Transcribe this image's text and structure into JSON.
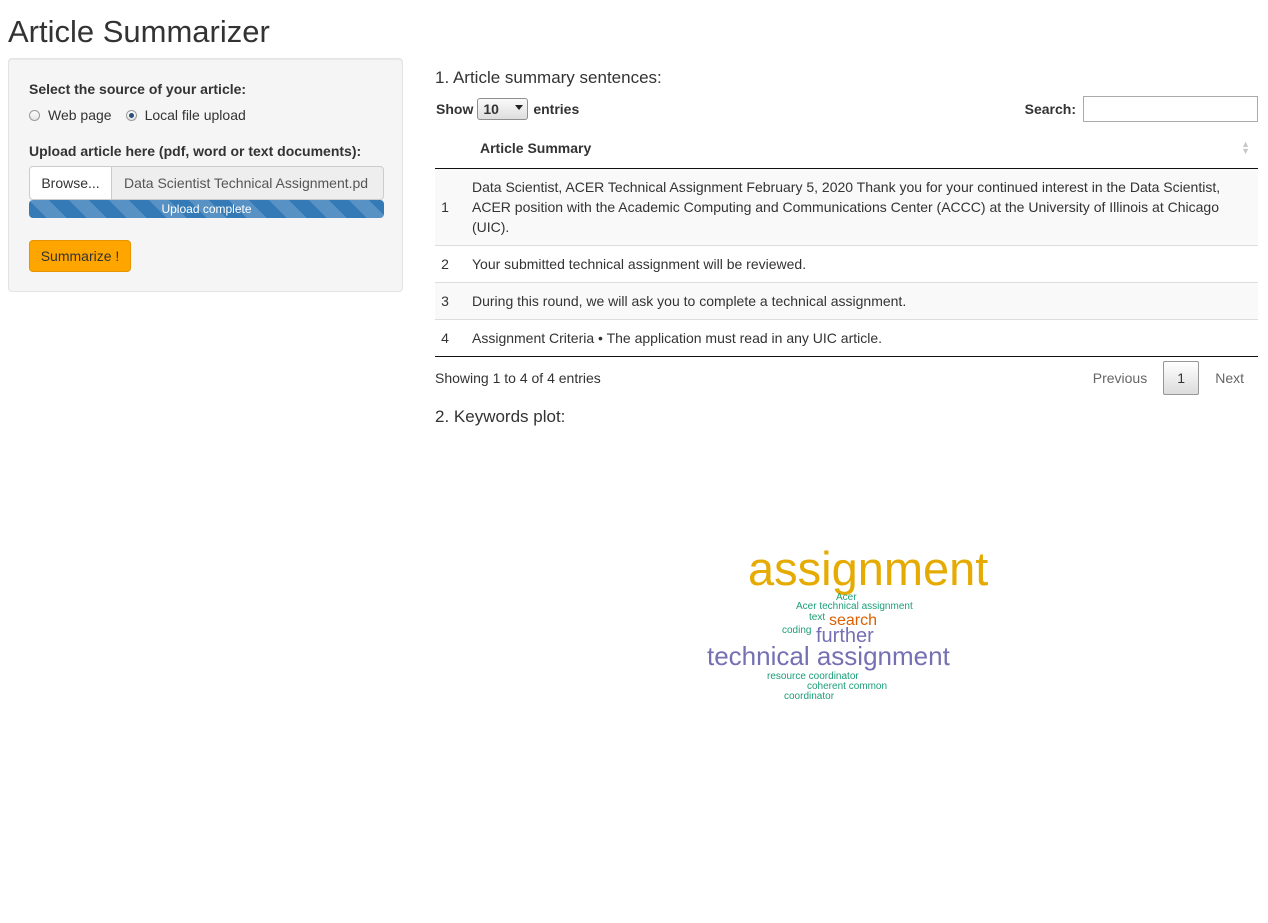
{
  "app": {
    "title": "Article Summarizer"
  },
  "sidebar": {
    "source_label": "Select the source of your article:",
    "source_options": [
      {
        "label": "Web page",
        "checked": false
      },
      {
        "label": "Local file upload",
        "checked": true
      }
    ],
    "upload_label": "Upload article here (pdf, word or text documents):",
    "browse_label": "Browse...",
    "file_name": "Data Scientist Technical Assignment.pd",
    "upload_progress_text": "Upload complete",
    "upload_progress_fraction": 1.0,
    "summarize_label": "Summarize !",
    "summarize_color": "#ffa500"
  },
  "summary": {
    "heading": "1. Article summary sentences:",
    "show_label": "Show",
    "page_size": "10",
    "entries_label": "entries",
    "search_label": "Search:",
    "search_value": "",
    "column_header": "Article Summary",
    "rows": [
      {
        "index": "1",
        "text": "Data Scientist, ACER Technical Assignment February 5, 2020 Thank you for your continued interest in the Data Scientist, ACER position with the Academic Computing and Communications Center (ACCC) at the University of Illinois at Chicago (UIC)."
      },
      {
        "index": "2",
        "text": "Your submitted technical assignment will be reviewed."
      },
      {
        "index": "3",
        "text": "During this round, we will ask you to complete a technical assignment."
      },
      {
        "index": "4",
        "text": "Assignment Criteria • The application must read in any UIC article."
      }
    ],
    "info_text": "Showing 1 to 4 of 4 entries",
    "previous_label": "Previous",
    "current_page": "1",
    "next_label": "Next"
  },
  "keywords": {
    "heading": "2. Keywords plot:",
    "words": [
      {
        "text": "assignment",
        "color": "#e6ab02"
      },
      {
        "text": "Acer",
        "color": "#1b9e77"
      },
      {
        "text": "Acer technical assignment",
        "color": "#1b9e77"
      },
      {
        "text": "text",
        "color": "#1b9e77"
      },
      {
        "text": "search",
        "color": "#d95f02"
      },
      {
        "text": "coding",
        "color": "#1b9e77"
      },
      {
        "text": "further",
        "color": "#7570b3"
      },
      {
        "text": "technical assignment",
        "color": "#7570b3"
      },
      {
        "text": "resource coordinator",
        "color": "#1b9e77"
      },
      {
        "text": "coherent common",
        "color": "#1b9e77"
      },
      {
        "text": "coordinator",
        "color": "#1b9e77"
      }
    ]
  }
}
